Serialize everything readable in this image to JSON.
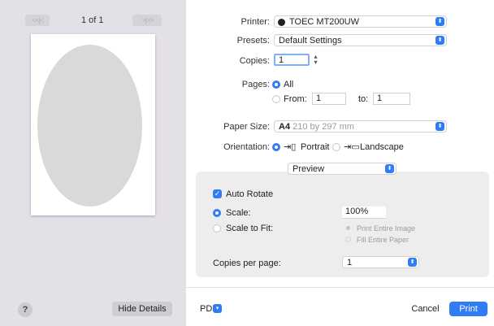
{
  "preview": {
    "first_label": "<<|<",
    "page_indicator": "1 of 1",
    "next_label": ">|>>",
    "help_label": "?",
    "hide_details_label": "Hide Details"
  },
  "printer": {
    "label": "Printer:",
    "value": "TOEC MT200UW"
  },
  "presets": {
    "label": "Presets:",
    "value": "Default Settings"
  },
  "copies": {
    "label": "Copies:",
    "value": "1"
  },
  "pages": {
    "label": "Pages:",
    "all_label": "All",
    "from_label": "From:",
    "from_value": "1",
    "to_label": "to:",
    "to_value": "1"
  },
  "paper_size": {
    "label": "Paper Size:",
    "value_bold": "A4",
    "value_detail": "210 by 297 mm"
  },
  "orientation": {
    "label": "Orientation:",
    "portrait": "Portrait",
    "landscape": "Landscape"
  },
  "section_popup": {
    "value": "Preview"
  },
  "preview_options": {
    "auto_rotate": "Auto Rotate",
    "scale": "Scale:",
    "scale_value": "100%",
    "scale_to_fit": "Scale to Fit:",
    "print_entire_image": "Print Entire Image",
    "fill_entire_paper": "Fill Entire Paper",
    "copies_per_page": "Copies per page:",
    "copies_per_page_value": "1"
  },
  "footer": {
    "pdf": "PDF",
    "cancel": "Cancel",
    "print": "Print"
  },
  "colors": {
    "accent": "#2f7cf6",
    "sidebar": "#e4e0e7"
  }
}
